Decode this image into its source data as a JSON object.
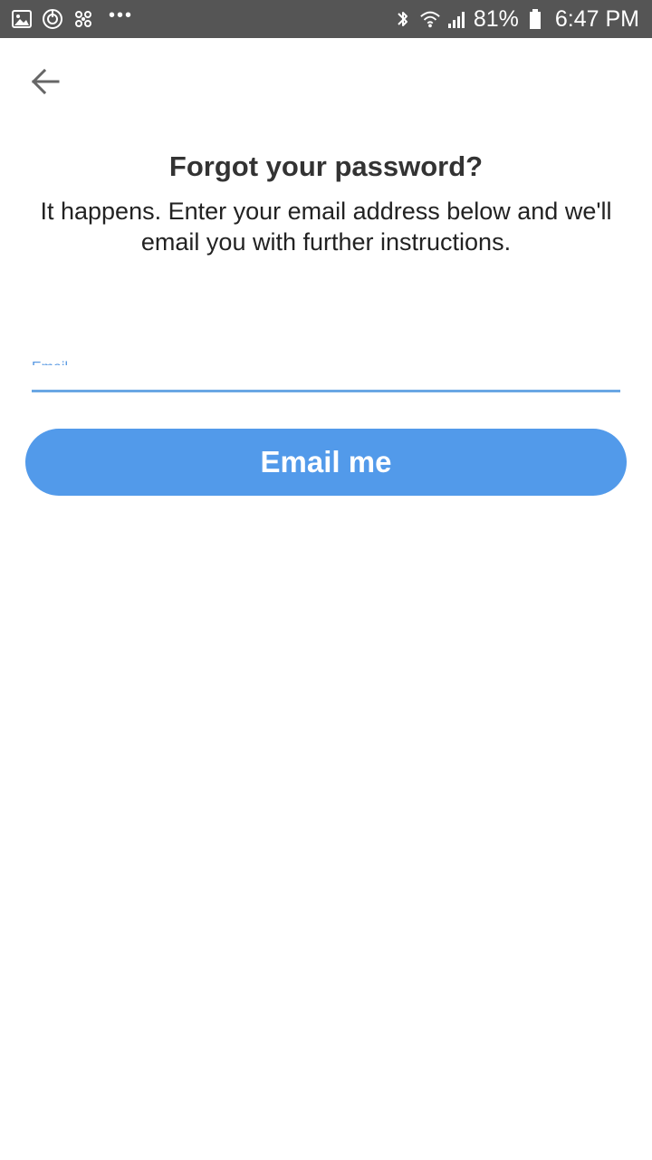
{
  "status_bar": {
    "left_icons": [
      "gallery-icon",
      "sync-icon",
      "network-icon"
    ],
    "overflow": "•••",
    "right_icons": [
      "bluetooth-icon",
      "wifi-icon",
      "signal-icon",
      "battery-icon"
    ],
    "battery_percent": "81%",
    "time": "6:47 PM",
    "background_color": "#555555"
  },
  "header": {
    "back_icon": "arrow-left-icon"
  },
  "main": {
    "title": "Forgot your password?",
    "subtitle": "It happens. Enter your email address below and we'll email you with further instructions.",
    "email_field": {
      "label": "Email",
      "value": "",
      "placeholder": ""
    },
    "submit_label": "Email me",
    "accent_color": "#529aea"
  }
}
